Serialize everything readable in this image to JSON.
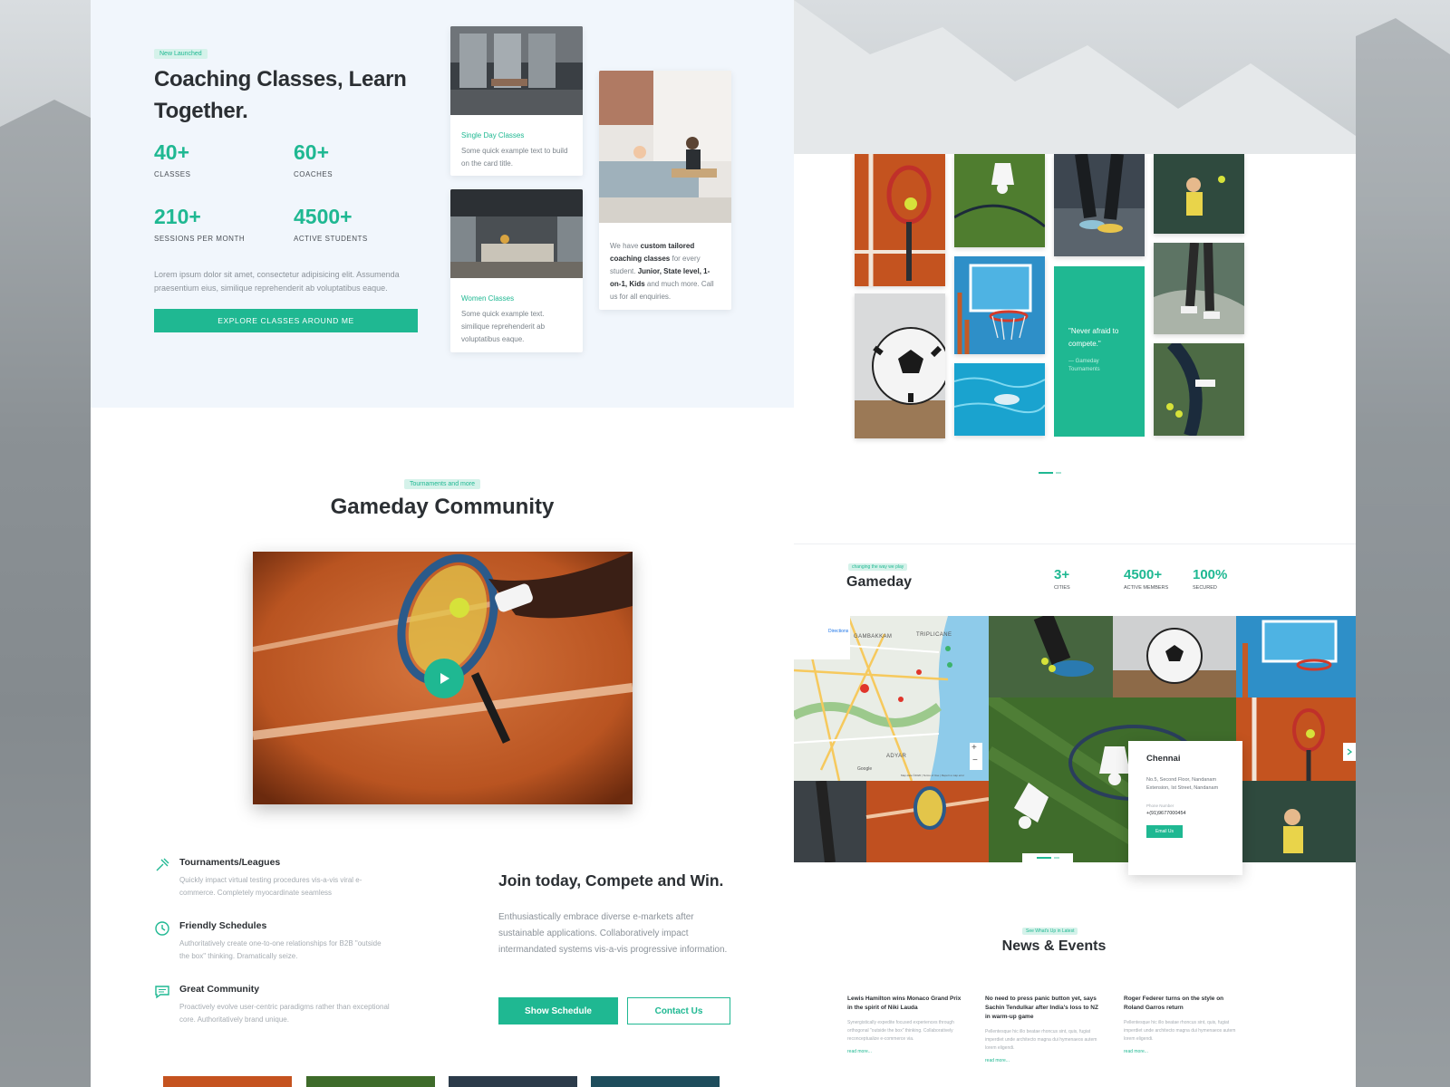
{
  "hero": {
    "tag": "New Launched",
    "title": "Coaching Classes, Learn Together.",
    "stats": [
      {
        "value": "40+",
        "label": "CLASSES"
      },
      {
        "value": "60+",
        "label": "COACHES"
      },
      {
        "value": "210+",
        "label": "SESSIONS PER MONTH"
      },
      {
        "value": "4500+",
        "label": "ACTIVE STUDENTS"
      }
    ],
    "description": "Lorem ipsum dolor sit amet, consectetur adipisicing elit. Assumenda praesentium eius, similique reprehenderit ab voluptatibus eaque.",
    "cta": "EXPLORE CLASSES AROUND ME",
    "cards": [
      {
        "title": "Single Day Classes",
        "body": "Some quick example text to build on the card title."
      },
      {
        "title": "Women Classes",
        "body": "Some quick example text. similique reprehenderit ab voluptatibus eaque."
      }
    ],
    "side_card": {
      "pre": "We have ",
      "bold1": "custom tailored coaching classes",
      "mid": " for every student. ",
      "bold2": "Junior, State level, 1-on-1, Kids",
      "post": " and much more. Call us for all enquiries."
    }
  },
  "community": {
    "tag": "Tournaments and more",
    "title": "Gameday Community",
    "features": [
      {
        "title": "Tournaments/Leagues",
        "desc": "Quickly impact virtual testing procedures vis-a-vis viral e-commerce. Completely myocardinate seamless"
      },
      {
        "title": "Friendly Schedules",
        "desc": "Authoritatively create one-to-one relationships for B2B \"outside the box\" thinking. Dramatically seize."
      },
      {
        "title": "Great Community",
        "desc": "Proactively evolve user-centric paradigms rather than exceptional core. Authoritatively brand unique."
      }
    ],
    "join_title": "Join today, Compete and Win.",
    "join_desc": "Enthusiastically embrace diverse e-markets after sustainable applications. Collaboratively impact intermandated systems vis-a-vis progressive information.",
    "show_schedule": "Show Schedule",
    "contact_us": "Contact Us"
  },
  "quote": {
    "text": "\"Never afraid to compete.\"",
    "source": "— Gameday Tournaments"
  },
  "gameday": {
    "tag": "changing the way we play",
    "title": "Gameday",
    "stats": [
      {
        "value": "3+",
        "label": "CITIES"
      },
      {
        "value": "4500+",
        "label": "ACTIVE MEMBERS"
      },
      {
        "value": "100%",
        "label": "SECURED"
      }
    ],
    "location": {
      "city": "Chennai",
      "address": "No.5, Second Floor, Nandanam Extension, Ist Street, Nandanam",
      "phone_label": "Phone Number",
      "phone": "+(91)9677000454",
      "email_btn": "Email Us"
    },
    "map_labels": {
      "directions": "Directions",
      "a": "GAMBAKKAM",
      "b": "TRIPLICANE",
      "c": "ADYAR",
      "google": "Google",
      "credits": "Map data ©2020 | Terms of Use | Report a map error"
    }
  },
  "news": {
    "tag": "See What's Up in Latest",
    "title": "News & Events",
    "read_more": "read more...",
    "items": [
      {
        "title": "Lewis Hamilton wins Monaco Grand Prix in the spirit of Niki Lauda",
        "desc": "Synergistically expedite focused experiences through orthogonal \"outside the box\" thinking. Collaboratively reconceptualize e-commerce via."
      },
      {
        "title": "No need to press panic button yet, says Sachin Tendulkar after India's loss to NZ in warm-up game",
        "desc": "Pellentesque hic illo beatae rhoncus sint, quis, fugiat imperdiet unde architecto magna dui hymenaeos autem lorem eligendi."
      },
      {
        "title": "Roger Federer turns on the style on Roland Garros return",
        "desc": "Pellentesque hic illo beatae rhoncus sint, quis, fugiat imperdiet unde architecto magna dui hymenaeos autem lorem eligendi."
      }
    ]
  },
  "colors": {
    "accent": "#1fb892",
    "hero_bg": "#f1f6fc"
  }
}
